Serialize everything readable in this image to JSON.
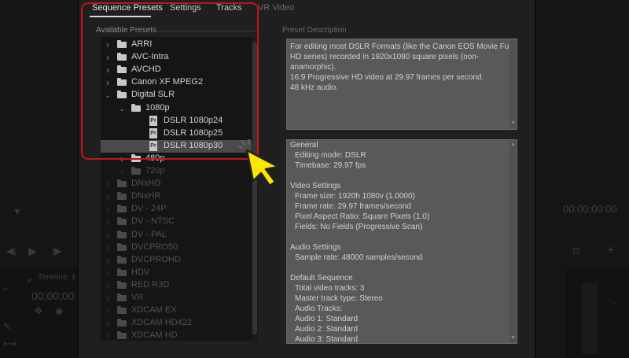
{
  "background": {
    "timecode_left": "00;00;00",
    "timecode_right": "00:00:00:00",
    "timeline_tab": "Timeline: 1"
  },
  "tabs": [
    {
      "label": "Sequence Presets",
      "active": true
    },
    {
      "label": "Settings",
      "active": false
    },
    {
      "label": "Tracks",
      "active": false
    },
    {
      "label": "VR Video",
      "active": false
    }
  ],
  "available_presets_label": "Available Presets",
  "preset_description_label": "Preset Description",
  "tree": [
    {
      "label": "ARRI",
      "type": "folder",
      "level": 0,
      "expanded": false,
      "state": "normal"
    },
    {
      "label": "AVC-Intra",
      "type": "folder",
      "level": 0,
      "expanded": false,
      "state": "normal"
    },
    {
      "label": "AVCHD",
      "type": "folder",
      "level": 0,
      "expanded": false,
      "state": "normal"
    },
    {
      "label": "Canon XF MPEG2",
      "type": "folder",
      "level": 0,
      "expanded": false,
      "state": "normal"
    },
    {
      "label": "Digital SLR",
      "type": "folder",
      "level": 0,
      "expanded": true,
      "state": "normal"
    },
    {
      "label": "1080p",
      "type": "folder",
      "level": 1,
      "expanded": true,
      "state": "normal"
    },
    {
      "label": "DSLR 1080p24",
      "type": "file",
      "level": 2,
      "state": "normal"
    },
    {
      "label": "DSLR 1080p25",
      "type": "file",
      "level": 2,
      "state": "normal"
    },
    {
      "label": "DSLR 1080p30",
      "type": "file",
      "level": 2,
      "state": "selected"
    },
    {
      "label": "480p",
      "type": "folder",
      "level": 1,
      "expanded": false,
      "state": "normal"
    },
    {
      "label": "720p",
      "type": "folder",
      "level": 1,
      "expanded": false,
      "state": "dim"
    },
    {
      "label": "DNxHD",
      "type": "folder",
      "level": 0,
      "expanded": false,
      "state": "dim"
    },
    {
      "label": "DNxHR",
      "type": "folder",
      "level": 0,
      "expanded": false,
      "state": "dim"
    },
    {
      "label": "DV - 24P",
      "type": "folder",
      "level": 0,
      "expanded": false,
      "state": "dim"
    },
    {
      "label": "DV - NTSC",
      "type": "folder",
      "level": 0,
      "expanded": false,
      "state": "dim"
    },
    {
      "label": "DV - PAL",
      "type": "folder",
      "level": 0,
      "expanded": false,
      "state": "dim"
    },
    {
      "label": "DVCPRO50",
      "type": "folder",
      "level": 0,
      "expanded": false,
      "state": "dim"
    },
    {
      "label": "DVCPROHD",
      "type": "folder",
      "level": 0,
      "expanded": false,
      "state": "dim"
    },
    {
      "label": "HDV",
      "type": "folder",
      "level": 0,
      "expanded": false,
      "state": "dim"
    },
    {
      "label": "RED R3D",
      "type": "folder",
      "level": 0,
      "expanded": false,
      "state": "dim"
    },
    {
      "label": "VR",
      "type": "folder",
      "level": 0,
      "expanded": false,
      "state": "dim"
    },
    {
      "label": "XDCAM EX",
      "type": "folder",
      "level": 0,
      "expanded": false,
      "state": "dim"
    },
    {
      "label": "XDCAM HD422",
      "type": "folder",
      "level": 0,
      "expanded": false,
      "state": "dim"
    },
    {
      "label": "XDCAM HD",
      "type": "folder",
      "level": 0,
      "expanded": false,
      "state": "dim"
    }
  ],
  "description": [
    "For editing most DSLR Formats (like the Canon EOS Movie Full",
    "HD series) recorded in 1920x1080 square pixels (non-",
    "anamorphic).",
    "16:9 Progressive HD video at 29.97 frames per second.",
    "48 kHz audio."
  ],
  "general_info": [
    {
      "text": "General",
      "indent": false
    },
    {
      "text": "Editing mode: DSLR",
      "indent": true
    },
    {
      "text": "Timebase: 29.97 fps",
      "indent": true
    },
    {
      "text": "",
      "indent": false
    },
    {
      "text": "Video Settings",
      "indent": false
    },
    {
      "text": "Frame size: 1920h 1080v (1.0000)",
      "indent": true
    },
    {
      "text": "Frame rate: 29.97  frames/second",
      "indent": true
    },
    {
      "text": "Pixel Aspect Ratio: Square Pixels (1.0)",
      "indent": true
    },
    {
      "text": "Fields: No Fields (Progressive Scan)",
      "indent": true
    },
    {
      "text": "",
      "indent": false
    },
    {
      "text": "Audio Settings",
      "indent": false
    },
    {
      "text": "Sample rate: 48000 samples/second",
      "indent": true
    },
    {
      "text": "",
      "indent": false
    },
    {
      "text": "Default Sequence",
      "indent": false
    },
    {
      "text": "Total video tracks: 3",
      "indent": true
    },
    {
      "text": "Master track type: Stereo",
      "indent": true
    },
    {
      "text": "Audio Tracks:",
      "indent": true
    },
    {
      "text": "Audio 1: Standard",
      "indent": true
    },
    {
      "text": "Audio 2: Standard",
      "indent": true
    },
    {
      "text": "Audio 3: Standard",
      "indent": true
    }
  ],
  "colors": {
    "highlight": "#c1141b",
    "cursor": "#ffe600",
    "selected_row": "#4a4a4a"
  }
}
